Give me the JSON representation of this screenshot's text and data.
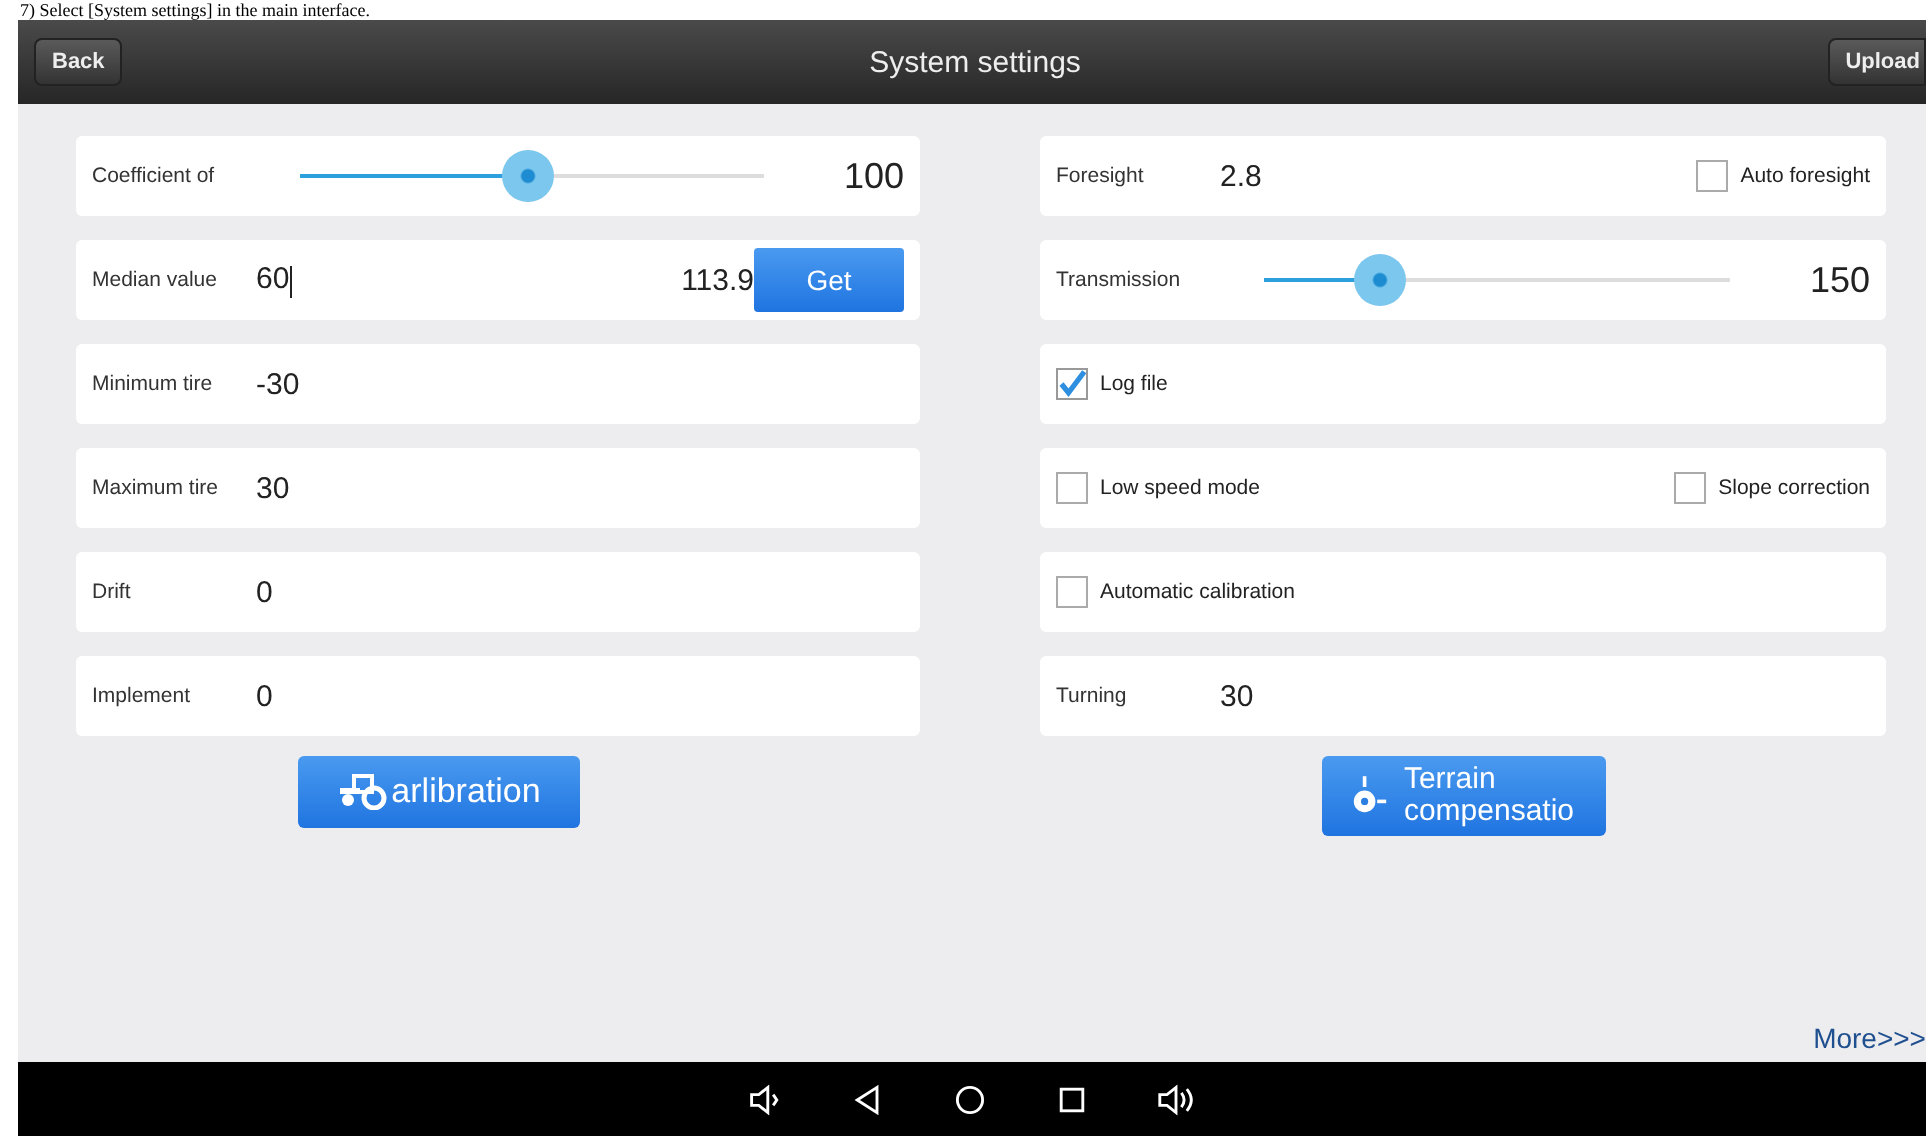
{
  "caption": "7) Select [System settings] in the main interface.",
  "top_bar": {
    "back": "Back",
    "title": "System settings",
    "upload": "Upload"
  },
  "left_rows": [
    {
      "kind": "slider",
      "label": "Coefficient of",
      "level": 0.49,
      "reading": "100"
    },
    {
      "kind": "get",
      "label": "Median value",
      "value": "60",
      "reading": "113.9",
      "button": "Get"
    },
    {
      "kind": "field",
      "label": "Minimum tire",
      "value": "-30"
    },
    {
      "kind": "field",
      "label": "Maximum tire",
      "value": "30"
    },
    {
      "kind": "field",
      "label": "Drift",
      "value": "0"
    },
    {
      "kind": "field",
      "label": "Implement",
      "value": "0"
    }
  ],
  "right_rows": [
    {
      "kind": "field",
      "label": "Foresight",
      "value": "2.8",
      "checks": [
        {
          "label": "Auto foresight",
          "checked": false
        }
      ]
    },
    {
      "kind": "slider",
      "label": "Transmission",
      "level": 0.25,
      "reading": "150"
    },
    {
      "kind": "checks",
      "checks": [
        {
          "label": "Log file",
          "checked": true
        }
      ]
    },
    {
      "kind": "checks",
      "checks": [
        {
          "label": "Low speed mode",
          "checked": false
        },
        {
          "label": "Slope correction",
          "checked": false
        }
      ]
    },
    {
      "kind": "checks",
      "checks": [
        {
          "label": "Automatic calibration",
          "checked": false
        }
      ]
    },
    {
      "kind": "field",
      "label": "Turning",
      "value": "30"
    }
  ],
  "calibration_button": "arlibration",
  "terrain_button": {
    "line_1": "Terrain",
    "line_2": "compensatio"
  },
  "more_link": "More>>>"
}
